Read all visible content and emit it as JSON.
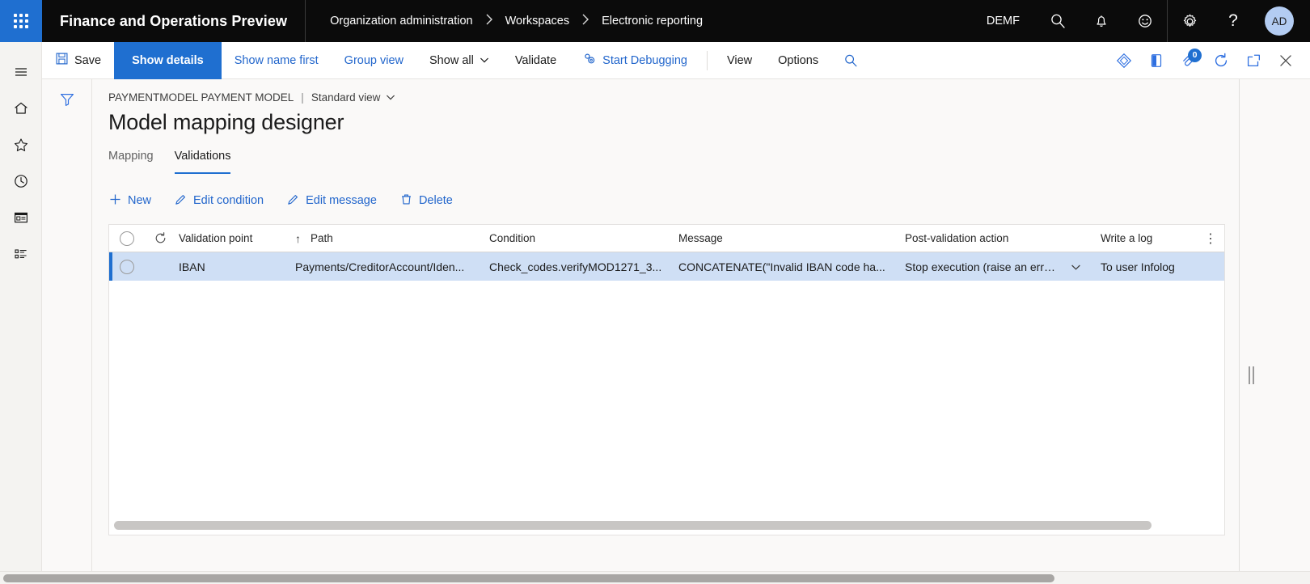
{
  "topbar": {
    "app_title": "Finance and Operations Preview",
    "breadcrumb": [
      "Organization administration",
      "Workspaces",
      "Electronic reporting"
    ],
    "chevron": "›",
    "company": "DEMF",
    "icons": [
      "search-icon",
      "notifications-icon",
      "feedback-icon",
      "settings-icon",
      "help-icon"
    ],
    "avatar_initials": "AD",
    "waffle_name": "app-launcher-icon",
    "accent_blue": "#1f6fd0",
    "background": "#0b0b0b"
  },
  "rail": {
    "items": [
      {
        "name": "hamburger-menu-icon"
      },
      {
        "name": "home-icon"
      },
      {
        "name": "favorites-star-icon"
      },
      {
        "name": "recent-clock-icon"
      },
      {
        "name": "workspaces-icon"
      },
      {
        "name": "modules-list-icon"
      }
    ]
  },
  "commandbar": {
    "save_label": "Save",
    "show_details_label": "Show details",
    "show_name_first_label": "Show name first",
    "group_view_label": "Group view",
    "show_all_label": "Show all",
    "validate_label": "Validate",
    "start_debugging_label": "Start Debugging",
    "view_label": "View",
    "options_label": "Options",
    "search_icon": "search-icon",
    "right_icons": [
      {
        "name": "personalize-diamond-icon"
      },
      {
        "name": "office-app-icon"
      },
      {
        "name": "attachments-icon",
        "badge": "0"
      },
      {
        "name": "refresh-icon"
      },
      {
        "name": "open-in-new-window-icon"
      },
      {
        "name": "close-icon"
      }
    ],
    "chevron_down": "⌄"
  },
  "filterstrip": {
    "filter_icon": "filter-funnel-icon"
  },
  "page": {
    "caption": "PAYMENTMODEL PAYMENT MODEL",
    "caption_separator": "|",
    "view_selector": "Standard view",
    "title": "Model mapping designer",
    "tabs": [
      {
        "label": "Mapping",
        "active": false
      },
      {
        "label": "Validations",
        "active": true
      }
    ],
    "actions": [
      {
        "label": "New",
        "icon": "plus-icon"
      },
      {
        "label": "Edit condition",
        "icon": "pencil-icon"
      },
      {
        "label": "Edit message",
        "icon": "pencil-icon"
      },
      {
        "label": "Delete",
        "icon": "trash-icon"
      }
    ]
  },
  "grid": {
    "columns": [
      "Validation point",
      "Path",
      "Condition",
      "Message",
      "Post-validation action",
      "Write a log"
    ],
    "sort_indicator": "↑",
    "sorted_column": "Validation point",
    "header_refresh_icon": "refresh-icon",
    "select_all_icon": "select-all-circle-icon",
    "column_options_icon": "more-vertical-icon",
    "column_options_glyph": "⋮",
    "rows": [
      {
        "selected": true,
        "validation_point": "IBAN",
        "path": "Payments/CreditorAccount/Iden...",
        "condition": "Check_codes.verifyMOD1271_3...",
        "message": "CONCATENATE(\"Invalid IBAN code ha...",
        "post_validation_action": "Stop execution (raise an error)",
        "write_a_log": "To user Infolog"
      }
    ]
  },
  "rightpane": {
    "splitter_name": "pane-splitter-handle"
  },
  "scrollbars": {
    "grid_horizontal": "grid-horizontal-scrollbar",
    "page_horizontal": "page-horizontal-scrollbar"
  }
}
